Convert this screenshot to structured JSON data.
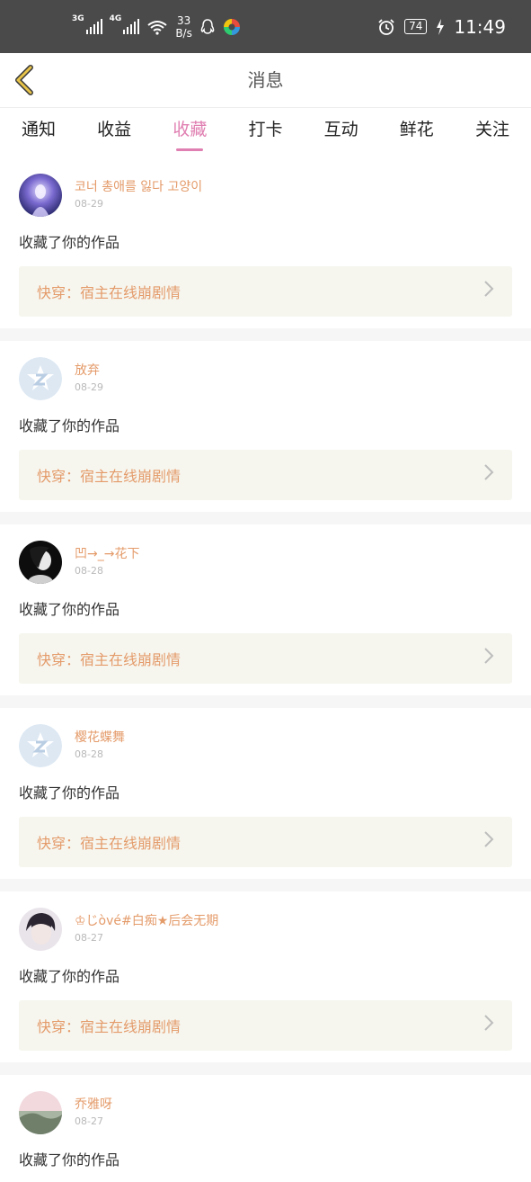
{
  "status_bar": {
    "net1": "3G",
    "net2": "4G",
    "speed_value": "33",
    "speed_unit": "B/s",
    "battery": "74",
    "time": "11:49"
  },
  "nav": {
    "back_icon": "chevron-left-icon",
    "title": "消息"
  },
  "tabs": [
    {
      "label": "通知"
    },
    {
      "label": "收益"
    },
    {
      "label": "收藏",
      "active": true
    },
    {
      "label": "打卡"
    },
    {
      "label": "互动"
    },
    {
      "label": "鲜花"
    },
    {
      "label": "关注"
    }
  ],
  "colors": {
    "accent": "#e07fb1",
    "username": "#e49b6a",
    "card_bg": "#f6f6ef",
    "status_bar": "#4a4a4a"
  },
  "notifications": [
    {
      "username": "코너 총애를 잃다 고양이",
      "date": "08-29",
      "action": "收藏了你的作品",
      "work_title": "快穿：宿主在线崩剧情"
    },
    {
      "username": "放弃",
      "date": "08-29",
      "action": "收藏了你的作品",
      "work_title": "快穿：宿主在线崩剧情"
    },
    {
      "username": "凹→_→花下",
      "date": "08-28",
      "action": "收藏了你的作品",
      "work_title": "快穿：宿主在线崩剧情"
    },
    {
      "username": "樱花蝶舞",
      "date": "08-28",
      "action": "收藏了你的作品",
      "work_title": "快穿：宿主在线崩剧情"
    },
    {
      "username": "♔じòvé#白痴★后会无期",
      "date": "08-27",
      "action": "收藏了你的作品",
      "work_title": "快穿：宿主在线崩剧情"
    },
    {
      "username": "乔雅呀",
      "date": "08-27",
      "action": "收藏了你的作品"
    }
  ]
}
